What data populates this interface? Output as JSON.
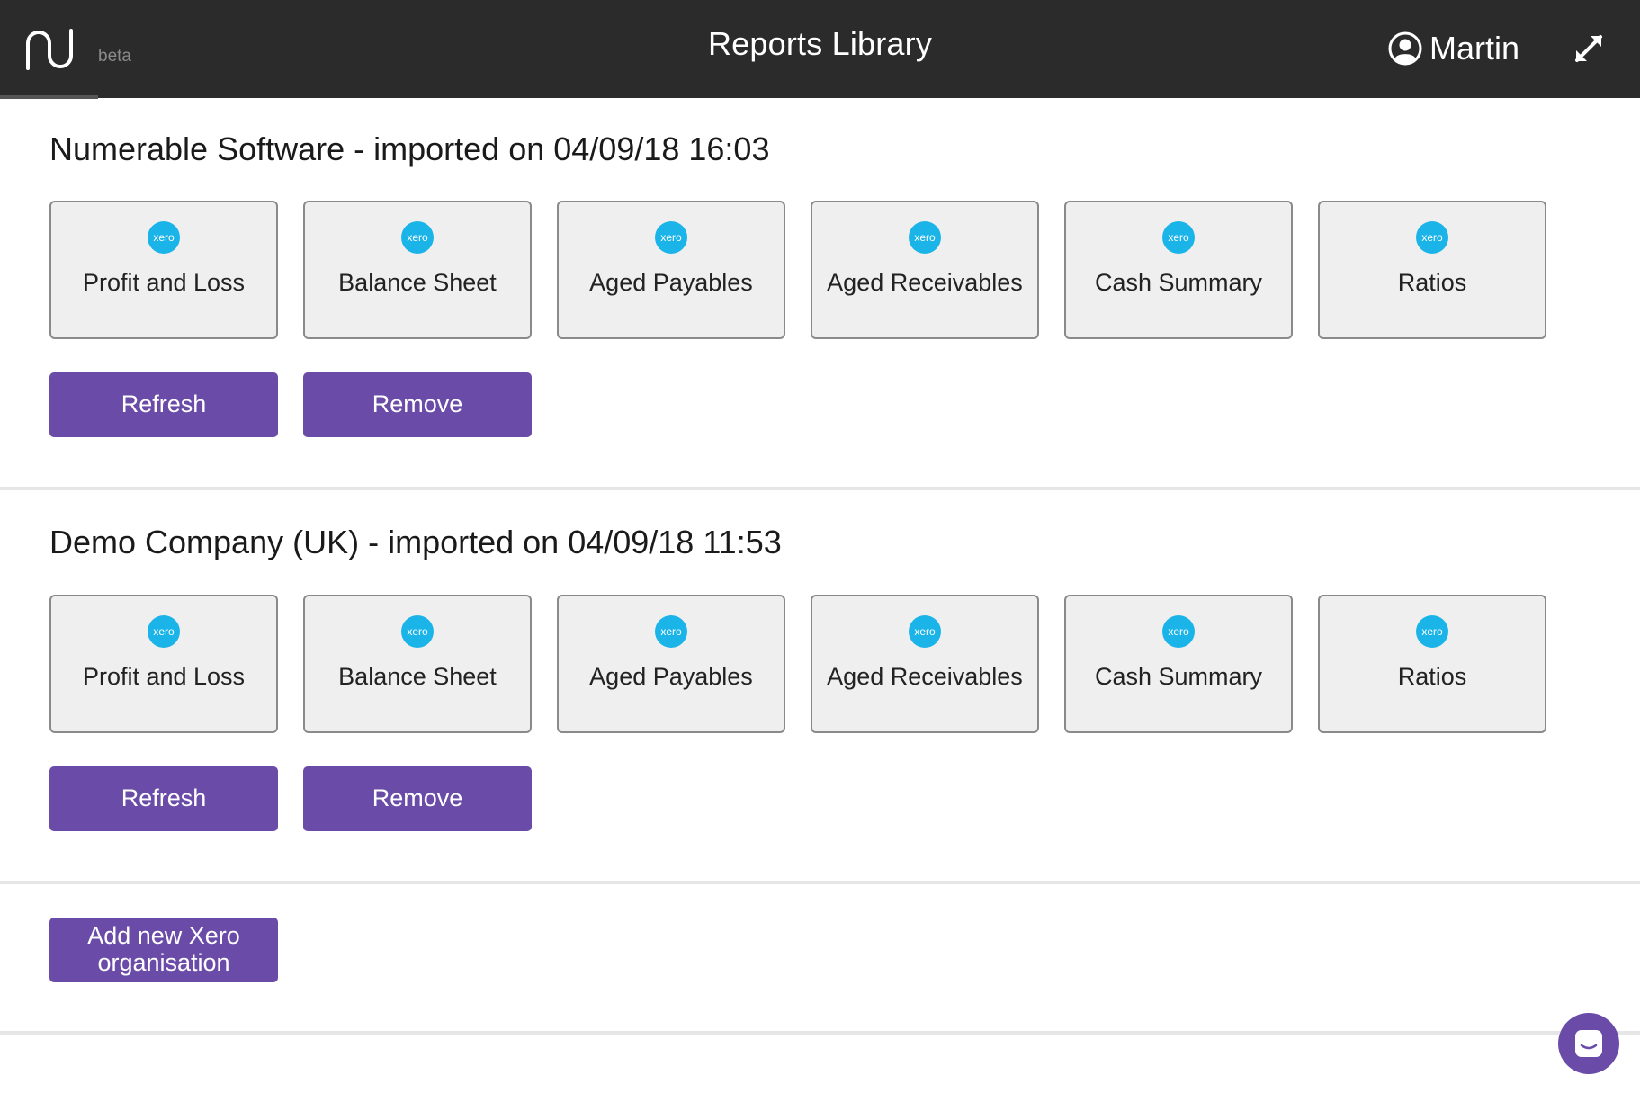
{
  "header": {
    "beta_label": "beta",
    "title": "Reports Library",
    "user_name": "Martin",
    "icons": {
      "logo": "numerable-logo-icon",
      "user": "user-circle-icon",
      "expand": "expand-icon"
    }
  },
  "colors": {
    "header_bg": "#2b2b2b",
    "accent": "#6a4ca8",
    "tile_bg": "#efefef",
    "xero_blue": "#1ab4e8"
  },
  "organisations": [
    {
      "title": "Numerable Software - imported on 04/09/18 16:03",
      "reports": [
        {
          "label": "Profit and Loss",
          "icon": "xero-logo-icon",
          "icon_text": "xero"
        },
        {
          "label": "Balance Sheet",
          "icon": "xero-logo-icon",
          "icon_text": "xero"
        },
        {
          "label": "Aged Payables",
          "icon": "xero-logo-icon",
          "icon_text": "xero"
        },
        {
          "label": "Aged Receivables",
          "icon": "xero-logo-icon",
          "icon_text": "xero"
        },
        {
          "label": "Cash Summary",
          "icon": "xero-logo-icon",
          "icon_text": "xero"
        },
        {
          "label": "Ratios",
          "icon": "xero-logo-icon",
          "icon_text": "xero"
        }
      ],
      "refresh_label": "Refresh",
      "remove_label": "Remove"
    },
    {
      "title": "Demo Company (UK) - imported on 04/09/18 11:53",
      "reports": [
        {
          "label": "Profit and Loss",
          "icon": "xero-logo-icon",
          "icon_text": "xero"
        },
        {
          "label": "Balance Sheet",
          "icon": "xero-logo-icon",
          "icon_text": "xero"
        },
        {
          "label": "Aged Payables",
          "icon": "xero-logo-icon",
          "icon_text": "xero"
        },
        {
          "label": "Aged Receivables",
          "icon": "xero-logo-icon",
          "icon_text": "xero"
        },
        {
          "label": "Cash Summary",
          "icon": "xero-logo-icon",
          "icon_text": "xero"
        },
        {
          "label": "Ratios",
          "icon": "xero-logo-icon",
          "icon_text": "xero"
        }
      ],
      "refresh_label": "Refresh",
      "remove_label": "Remove"
    }
  ],
  "add_org_label_line1": "Add new Xero",
  "add_org_label_line2": "organisation",
  "chat_icon": "chat-bubble-icon"
}
